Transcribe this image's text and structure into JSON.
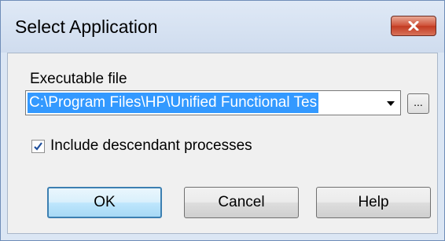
{
  "window": {
    "title": "Select Application"
  },
  "form": {
    "executable_label": "Executable file",
    "executable_value": "C:\\Program Files\\HP\\Unified Functional Tes",
    "browse_label": "...",
    "include_descendants_label": "Include descendant processes",
    "include_descendants_checked": true
  },
  "buttons": {
    "ok": "OK",
    "cancel": "Cancel",
    "help": "Help"
  },
  "icons": {
    "close": "close-icon",
    "dropdown": "chevron-down-icon",
    "check": "checkmark-icon"
  },
  "colors": {
    "selection": "#3399ff",
    "close_button": "#c23b22",
    "default_button_border": "#3c7fb1"
  }
}
